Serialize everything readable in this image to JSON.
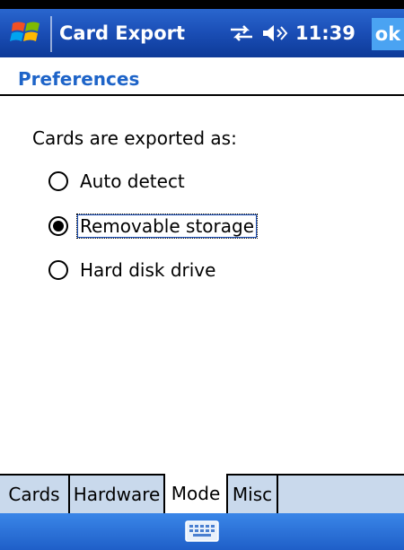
{
  "app": {
    "title": "Card Export",
    "time": "11:39",
    "ok_label": "ok",
    "icons": [
      "windows-start-icon",
      "connectivity-icon",
      "volume-icon",
      "keyboard-icon"
    ]
  },
  "page": {
    "title": "Preferences",
    "prompt": "Cards are exported as:"
  },
  "options": [
    {
      "label": "Auto detect",
      "checked": false
    },
    {
      "label": "Removable storage",
      "checked": true
    },
    {
      "label": "Hard disk drive",
      "checked": false
    }
  ],
  "tabs": [
    {
      "label": "Cards",
      "active": false
    },
    {
      "label": "Hardware",
      "active": false
    },
    {
      "label": "Mode",
      "active": true
    },
    {
      "label": "Misc",
      "active": false
    }
  ],
  "colors": {
    "title_bar": "#1b4fb7",
    "ok_button": "#4aa3f2",
    "section_title": "#1e64c8",
    "tab_bar": "#c9d9ec"
  }
}
